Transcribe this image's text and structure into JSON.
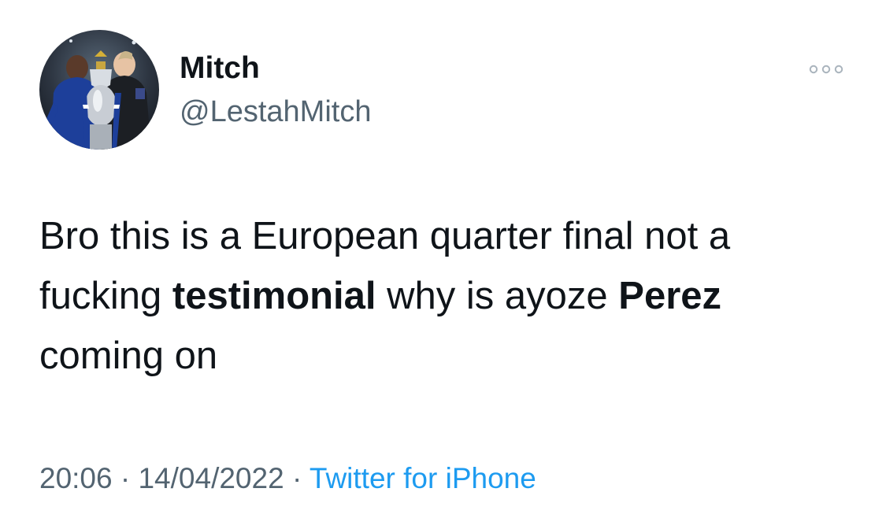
{
  "author": {
    "display_name": "Mitch",
    "handle": "@LestahMitch",
    "avatar_icon": "profile-photo-trophy"
  },
  "more_icon": "more-dots-icon",
  "tweet": {
    "segments": [
      {
        "text": "Bro this is a European quarter final not a fucking ",
        "bold": false
      },
      {
        "text": "testimonial",
        "bold": true
      },
      {
        "text": " why is ayoze ",
        "bold": false
      },
      {
        "text": "Perez",
        "bold": true
      },
      {
        "text": " coming on",
        "bold": false
      }
    ]
  },
  "meta": {
    "time": "20:06",
    "separator": "·",
    "date": "14/04/2022",
    "source": "Twitter for iPhone"
  },
  "colors": {
    "text_primary": "#0f1419",
    "text_secondary": "#536471",
    "link": "#1d9bf0",
    "background": "#ffffff"
  }
}
